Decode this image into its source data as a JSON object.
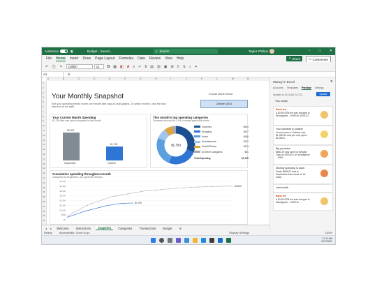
{
  "title_bar": {
    "autosave_label": "AutoSave",
    "autosave_state": "On",
    "doc_title": "Budget - Saved...",
    "search_placeholder": "Search",
    "user_name": "Taylor Phillips",
    "window_controls": [
      "−",
      "□",
      "✕"
    ]
  },
  "menu": {
    "tabs": [
      "File",
      "Home",
      "Insert",
      "Draw",
      "Page Layout",
      "Formulas",
      "Data",
      "Review",
      "View",
      "Help"
    ],
    "active": "Home",
    "share": "Share",
    "comments": "Comments"
  },
  "ribbon": {
    "font_name": "Calibri",
    "font_size": "11"
  },
  "formula_bar": {
    "name_box": "A1",
    "fx": "fx"
  },
  "sheet": {
    "columns": [
      "A",
      "B",
      "C",
      "D",
      "E",
      "F",
      "G",
      "H",
      "I",
      "J",
      "K",
      "L",
      "M",
      "N"
    ],
    "rows": [
      "1",
      "2",
      "3",
      "4",
      "5",
      "6",
      "7",
      "8",
      "9",
      "10",
      "11",
      "12",
      "13",
      "14",
      "15",
      "16",
      "17",
      "18",
      "19",
      "20",
      "21",
      "22",
      "23",
      "24",
      "25",
      "26",
      "27",
      "28",
      "29",
      "30"
    ],
    "title": "Your Monthly Snapshot",
    "description": "See your spending trends month over month with easy-to-read graphs. To switch months, click the blue data box to the right.",
    "month_label": "Choose Month Below",
    "month_value": "October 2021"
  },
  "chart_data": [
    {
      "type": "bar",
      "title": "Your Current Month Spending",
      "subtitle": "$1,750 less was spent compared to last month",
      "categories": [
        "September",
        "October"
      ],
      "values": [
        3500,
        1750
      ],
      "data_labels": [
        "$3,500",
        "$1,750"
      ],
      "ylim": [
        0,
        4000
      ],
      "colors": [
        "#7f8c93",
        "#2f76d4"
      ]
    },
    {
      "type": "pie",
      "title": "This month's top spending categories",
      "subtitle": "Groceries account for 31% of money spent this month",
      "center_label": "$1,750",
      "labels": [
        "Groceries",
        "Shopping",
        "Home",
        "Entertainment",
        "Health/Fitness",
        "All Other Categories"
      ],
      "values": [
        544,
        437,
        438,
        157,
        113,
        61
      ],
      "value_labels": [
        "$544",
        "$437",
        "$438",
        "$157",
        "$113",
        "$61"
      ],
      "colors": [
        "#1c4f8f",
        "#2f76d4",
        "#5aa0df",
        "#9ec6ee",
        "#e2a33b",
        "#a7a7a7"
      ],
      "total_label": "Total Spending",
      "total_value": "$1,750"
    },
    {
      "type": "line",
      "title": "Cumulative spending throughout month",
      "subtitle": "Compared to September, you spent $1,750 less",
      "y_ticks": [
        "$4,000",
        "$3,500",
        "$3,000",
        "$2,500",
        "$2,000",
        "$1,500",
        "$1,000",
        "$500",
        "$0"
      ],
      "ylim": [
        0,
        4000
      ],
      "x": [
        1,
        2,
        3,
        4,
        5,
        6,
        7,
        8,
        9,
        10,
        11,
        12,
        13,
        14,
        15,
        16,
        17,
        18,
        19,
        20,
        21,
        22,
        23,
        24,
        25,
        26,
        27,
        28,
        29,
        30,
        31
      ],
      "series": [
        {
          "name": "Previous Month",
          "values": [
            350,
            700,
            1000,
            1300,
            1600,
            1800,
            2000,
            2200,
            2400,
            2500,
            2600,
            2700,
            2800,
            2900,
            3000,
            3050,
            3100,
            3150,
            3200,
            3250,
            3300,
            3330,
            3360,
            3390,
            3420,
            3440,
            3460,
            3480,
            3490,
            3500,
            3500
          ],
          "end_label": "$3,500",
          "color": "#7f8c93"
        },
        {
          "name": "Current Month",
          "values": [
            250,
            450,
            650,
            850,
            1000,
            1150,
            1300,
            1450,
            1550,
            1650,
            1700,
            1730,
            1750
          ],
          "end_label": "$1,750",
          "color": "#2f76d4"
        }
      ]
    }
  ],
  "sheet_tabs": [
    "Welcome",
    "Instructions",
    "Snapshot",
    "Categories",
    "Transactions",
    "Budget"
  ],
  "active_sheet": "Snapshot",
  "status": {
    "ready": "Ready",
    "accessibility": "Accessibility: Good to go",
    "display_settings": "Display Settings",
    "zoom": "100%"
  },
  "side_pane": {
    "title": "Money in Excel",
    "tabs": [
      "Accounts",
      "Templates",
      "Preview",
      "Settings"
    ],
    "active_tab": "Preview",
    "updated": "Updated at 10:15 AM, 10/7/21",
    "update_button": "Update",
    "section_this_month": "This month",
    "cards": [
      {
        "tag": "Bank fee",
        "body": "A $3.99 ATM fee was charged to Woodgrove ...0009 on 10/01/21"
      },
      {
        "tag": "Your cashflow is positive",
        "body": "Your income in October was $1,050.33 and you only spent $1,050.0"
      },
      {
        "tag": "Big purchase",
        "body": "$680.29 was spent at Wingtip Toys on 09/24/21 on Woodgrove ...0009"
      },
      {
        "tag": "Monthly spending is down",
        "body": "That's $696.57 less in September than usual, to be exact"
      }
    ],
    "section_last_month": "Last month",
    "last_month_card": {
      "tag": "Bank fee",
      "body": "A $3.99 ATM fee was charged to Woodgrove ...0009 on"
    }
  },
  "taskbar": {
    "time": "11:11 AM",
    "date": "10/7/2021"
  }
}
